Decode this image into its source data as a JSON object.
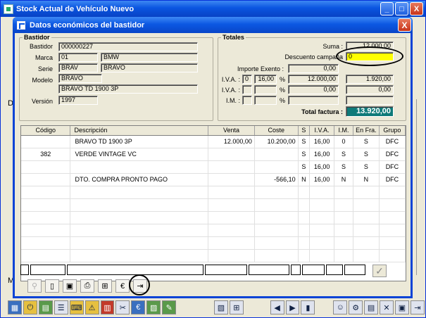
{
  "main_window": {
    "title": "Stock Actual de Vehículo Nuevo",
    "minimize": "_",
    "maximize": "□",
    "close": "X",
    "side_label_top": "D",
    "side_label_bottom": "M"
  },
  "dialog": {
    "title": "Datos económicos del bastidor",
    "close": "X",
    "bastidor": {
      "legend": "Bastidor",
      "bastidor_label": "Bastidor",
      "bastidor_value": "000000227",
      "marca_label": "Marca",
      "marca_code": "01",
      "marca_name": "BMW",
      "serie_label": "Serie",
      "serie_code": "BRAV",
      "serie_name": "BRAVO",
      "modelo_label": "Modelo",
      "modelo_code": "BRAVO",
      "modelo_name": "BRAVO TD 1900 3P",
      "version_label": "Versión",
      "version_value": "1997"
    },
    "totales": {
      "legend": "Totales",
      "suma_label": "Suma :",
      "suma_value": "12.000,00",
      "descuento_label": "Descuento campaña",
      "descuento_value": "0",
      "importe_exento_label": "Importe Exento :",
      "importe_exento_value": "0,00",
      "iva1_label": "I.V.A. :",
      "iva1_code": "0",
      "iva1_rate": "16,00",
      "iva1_pct": "%",
      "iva1_base": "12.000,00",
      "iva1_amount": "1.920,00",
      "iva2_label": "I.V.A. :",
      "iva2_pct": "%",
      "iva2_base": "0,00",
      "iva2_amount": "0,00",
      "im_label": "I.M. :",
      "im_pct": "%",
      "total_label": "Total factura :",
      "total_value": "13.920,00"
    },
    "grid": {
      "columns": [
        "Código",
        "Descripción",
        "Venta",
        "Coste",
        "S",
        "I.V.A.",
        "I.M.",
        "En Fra.",
        "Grupo"
      ],
      "rows": [
        [
          "",
          "BRAVO TD 1900 3P",
          "12.000,00",
          "10.200,00",
          "S",
          "16,00",
          "0",
          "S",
          "DFC"
        ],
        [
          "382",
          "VERDE VINTAGE    VC",
          "",
          "",
          "S",
          "16,00",
          "S",
          "S",
          "DFC"
        ],
        [
          "",
          "",
          "",
          "",
          "S",
          "16,00",
          "S",
          "S",
          "DFC"
        ],
        [
          "",
          "DTO. COMPRA PRONTO PAGO",
          "",
          "-566,10",
          "N",
          "16,00",
          "N",
          "N",
          "DFC"
        ],
        [
          "",
          "",
          "",
          "",
          "",
          "",
          "",
          "",
          ""
        ],
        [
          "",
          "",
          "",
          "",
          "",
          "",
          "",
          "",
          ""
        ],
        [
          "",
          "",
          "",
          "",
          "",
          "",
          "",
          "",
          ""
        ],
        [
          "",
          "",
          "",
          "",
          "",
          "",
          "",
          "",
          ""
        ],
        [
          "",
          "",
          "",
          "",
          "",
          "",
          "",
          "",
          ""
        ],
        [
          "",
          "",
          "",
          "",
          "",
          "",
          "",
          "",
          ""
        ]
      ]
    },
    "accept_icon": "✓",
    "toolbar": [
      {
        "name": "search-icon",
        "glyph": "⚲"
      },
      {
        "name": "new-document-icon",
        "glyph": "▯"
      },
      {
        "name": "save-disk-icon",
        "glyph": "▣"
      },
      {
        "name": "print-icon",
        "glyph": "⎙"
      },
      {
        "name": "calculator-icon",
        "glyph": "⊞"
      },
      {
        "name": "economic-data-icon",
        "glyph": "€"
      },
      {
        "name": "exit-door-icon",
        "glyph": "⇥"
      }
    ]
  },
  "bottom_toolbar": {
    "left": [
      {
        "name": "grid-icon",
        "glyph": "▦"
      },
      {
        "name": "power-icon",
        "glyph": "⏻"
      },
      {
        "name": "calendar-icon",
        "glyph": "▤"
      },
      {
        "name": "list-icon",
        "glyph": "☰"
      },
      {
        "name": "keyboard-icon",
        "glyph": "⌨"
      },
      {
        "name": "warning-icon",
        "glyph": "⚠"
      },
      {
        "name": "calculator-icon",
        "glyph": "▥"
      },
      {
        "name": "tools-icon",
        "glyph": "✂"
      },
      {
        "name": "euro-icon",
        "glyph": "€"
      },
      {
        "name": "chart-icon",
        "glyph": "▨"
      },
      {
        "name": "pencil-icon",
        "glyph": "✎"
      }
    ],
    "mid": [
      {
        "name": "book-icon",
        "glyph": "▧"
      },
      {
        "name": "tree-icon",
        "glyph": "⊞"
      }
    ],
    "nav": [
      {
        "name": "first-record-icon",
        "glyph": "◀"
      },
      {
        "name": "prev-record-icon",
        "glyph": "▶"
      },
      {
        "name": "last-record-icon",
        "glyph": "▮"
      }
    ],
    "right": [
      {
        "name": "user-icon",
        "glyph": "☺"
      },
      {
        "name": "settings-icon",
        "glyph": "⚙"
      },
      {
        "name": "clipboard-icon",
        "glyph": "▤"
      },
      {
        "name": "delete-icon",
        "glyph": "✕"
      },
      {
        "name": "save-icon",
        "glyph": "▣"
      },
      {
        "name": "exit-icon",
        "glyph": "⇥"
      }
    ]
  }
}
